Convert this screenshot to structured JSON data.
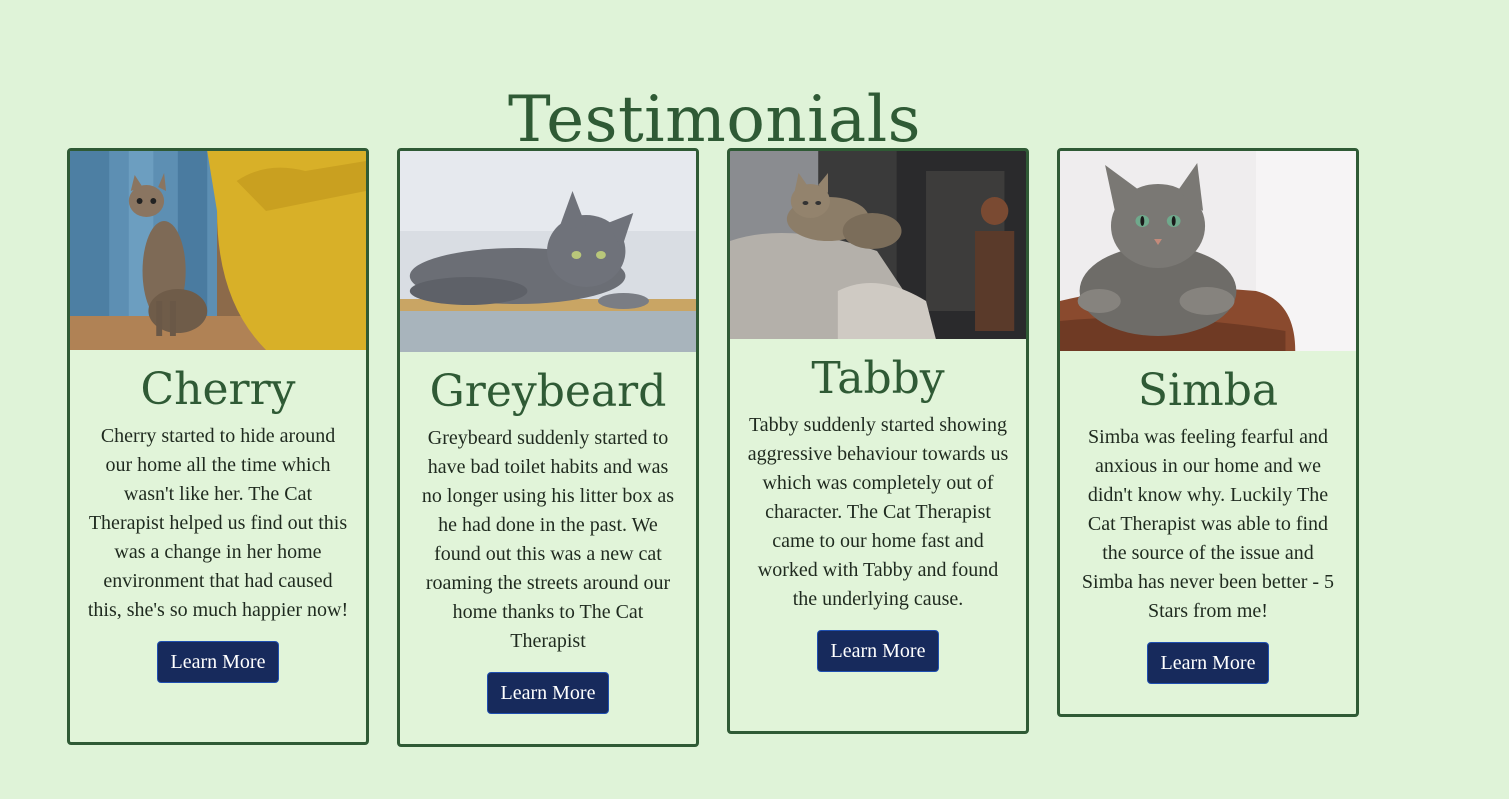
{
  "page": {
    "title": "Testimonials",
    "background": "#dff3d8",
    "accent": "#2f5a35",
    "button_color": "#172a5c"
  },
  "cards": [
    {
      "name": "Cherry",
      "image_icon": "tabby-kitten-photo-icon",
      "text": "Cherry started to hide around our home all the time which wasn't like her. The Cat Therapist helped us find out this was a change in her home environment that had caused this, she's so much happier now!",
      "button_label": "Learn More"
    },
    {
      "name": "Greybeard",
      "image_icon": "grey-cat-photo-icon",
      "text": "Greybeard suddenly started to have bad toilet habits and was no longer using his litter box as he had done in the past. We found out this was a new cat roaming the streets around our home thanks to The Cat Therapist",
      "button_label": "Learn More"
    },
    {
      "name": "Tabby",
      "image_icon": "tabby-on-sofa-photo-icon",
      "text": "Tabby suddenly started showing aggressive behaviour towards us which was completely out of character. The Cat Therapist came to our home fast and worked with Tabby and found the underlying cause.",
      "button_label": "Learn More"
    },
    {
      "name": "Simba",
      "image_icon": "tabby-cat-portrait-photo-icon",
      "text": "Simba was feeling fearful and anxious in our home and we didn't know why. Luckily The Cat Therapist was able to find the source of the issue and Simba has never been better - 5 Stars from me!",
      "button_label": "Learn More"
    }
  ]
}
